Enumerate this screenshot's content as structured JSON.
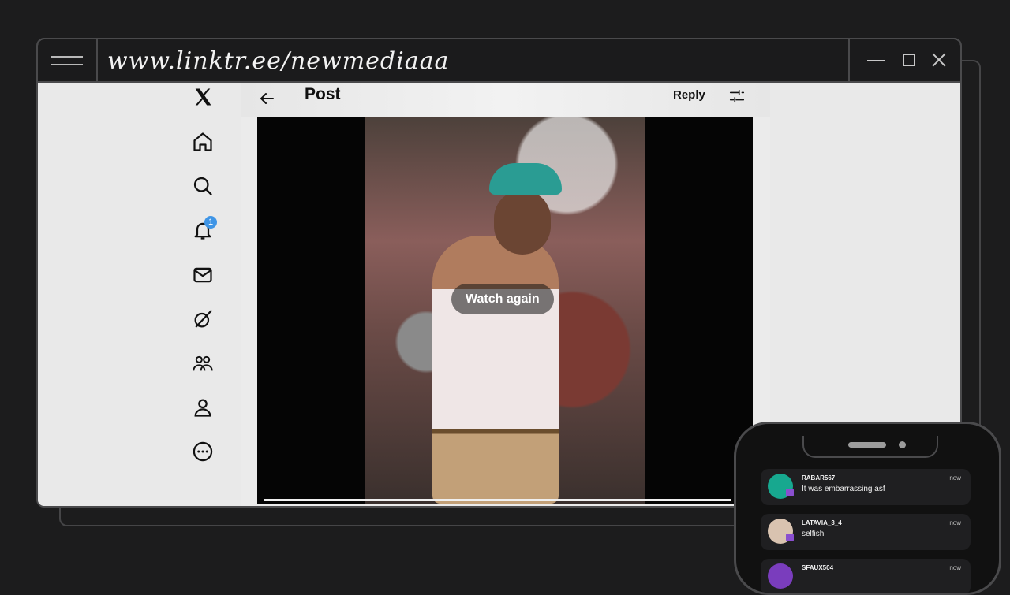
{
  "browser": {
    "url_text": "www.linktr.ee/newmediaaa"
  },
  "sidebar": {
    "notification_badge": "1",
    "items": [
      {
        "name": "x-logo-icon"
      },
      {
        "name": "home-icon"
      },
      {
        "name": "search-icon"
      },
      {
        "name": "bell-icon"
      },
      {
        "name": "mail-icon"
      },
      {
        "name": "grok-icon"
      },
      {
        "name": "communities-icon"
      },
      {
        "name": "profile-icon"
      },
      {
        "name": "more-icon"
      },
      {
        "name": "compose-icon"
      }
    ]
  },
  "post": {
    "title": "Post",
    "reply_label": "Reply",
    "video": {
      "overlay_label": "Watch again",
      "progress": 1.0
    }
  },
  "phone_chat": {
    "messages": [
      {
        "user": "RABAR567",
        "text": "It was embarrassing asf",
        "time": "now",
        "avatar_color": "#17a88f"
      },
      {
        "user": "LATAVIA_3_4",
        "text": "selfish",
        "time": "now",
        "avatar_color": "#d9c3b0"
      },
      {
        "user": "SFAUX504",
        "text": "",
        "time": "now",
        "avatar_color": "#7a3dbd"
      }
    ]
  },
  "colors": {
    "background": "#1c1c1d",
    "badge": "#3f95e6",
    "chat_sub_badge": "#8a4fcf"
  }
}
